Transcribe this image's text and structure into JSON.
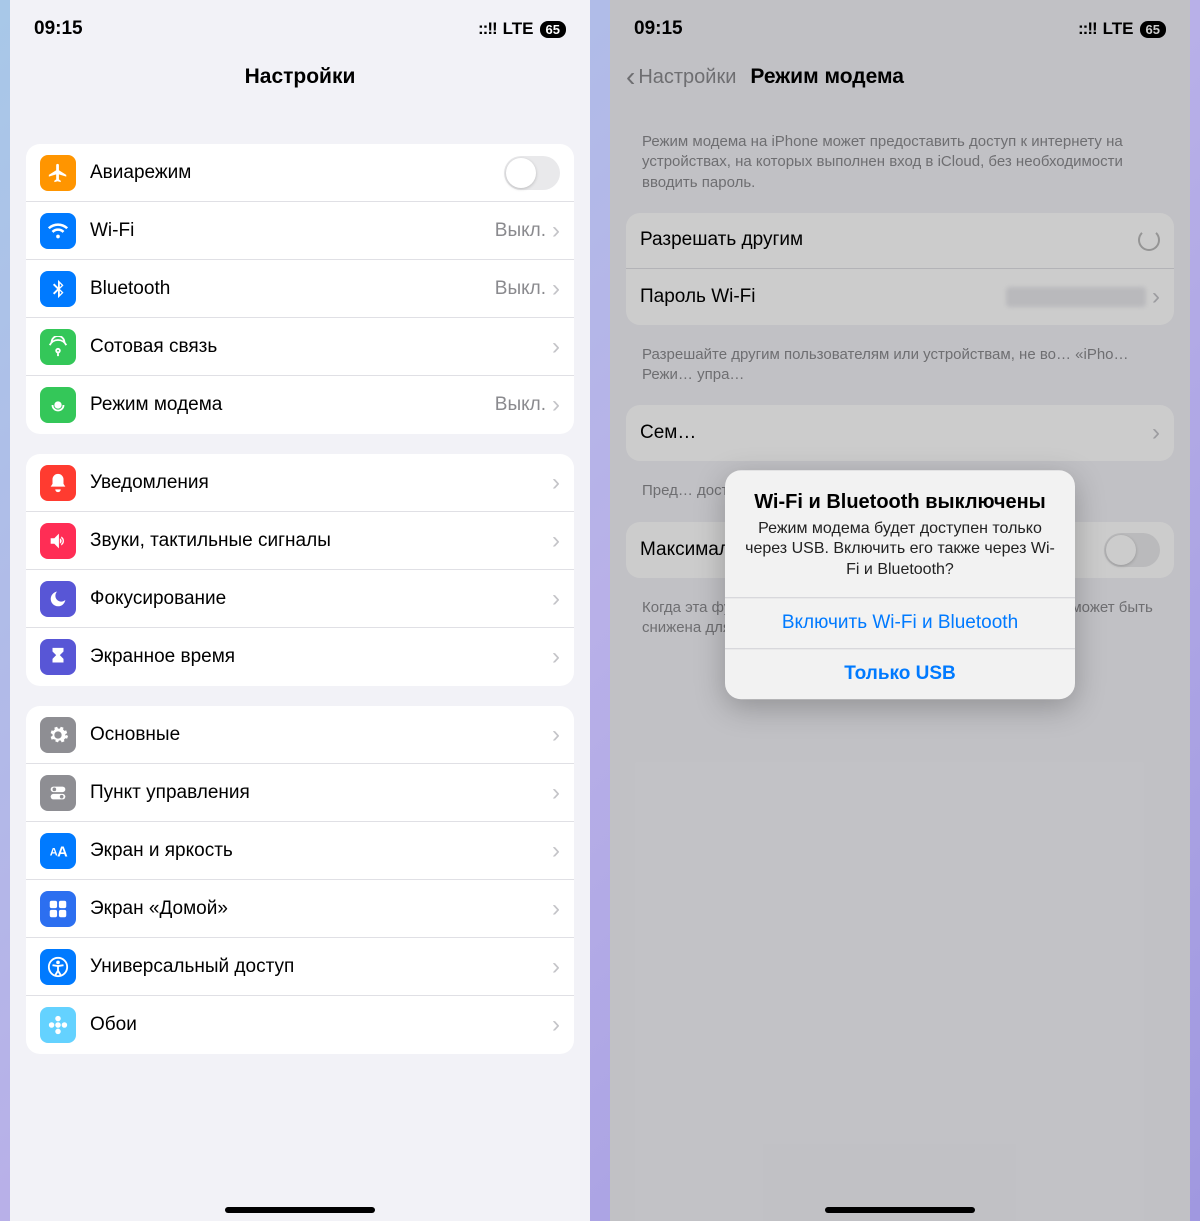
{
  "status": {
    "time": "09:15",
    "carrier": "LTE",
    "battery": "65"
  },
  "left": {
    "title": "Настройки",
    "groups": [
      {
        "rows": [
          {
            "icon": "airplane",
            "bg": "bg-orange",
            "label": "Авиарежим",
            "type": "toggle"
          },
          {
            "icon": "wifi",
            "bg": "bg-blue",
            "label": "Wi-Fi",
            "value": "Выкл.",
            "type": "link"
          },
          {
            "icon": "bluetooth",
            "bg": "bg-blue",
            "label": "Bluetooth",
            "value": "Выкл.",
            "type": "link"
          },
          {
            "icon": "cellular",
            "bg": "bg-green",
            "label": "Сотовая связь",
            "type": "link"
          },
          {
            "icon": "hotspot",
            "bg": "bg-green",
            "label": "Режим модема",
            "value": "Выкл.",
            "type": "link"
          }
        ]
      },
      {
        "rows": [
          {
            "icon": "bell",
            "bg": "bg-red",
            "label": "Уведомления",
            "type": "link"
          },
          {
            "icon": "speaker",
            "bg": "bg-pink",
            "label": "Звуки, тактильные сигналы",
            "type": "link"
          },
          {
            "icon": "moon",
            "bg": "bg-indigo",
            "label": "Фокусирование",
            "type": "link"
          },
          {
            "icon": "hourglass",
            "bg": "bg-indigo",
            "label": "Экранное время",
            "type": "link"
          }
        ]
      },
      {
        "rows": [
          {
            "icon": "gear",
            "bg": "bg-gray",
            "label": "Основные",
            "type": "link"
          },
          {
            "icon": "switches",
            "bg": "bg-grayd",
            "label": "Пункт управления",
            "type": "link"
          },
          {
            "icon": "aa",
            "bg": "bg-bluea",
            "label": "Экран и яркость",
            "type": "link"
          },
          {
            "icon": "grid",
            "bg": "bg-bluec",
            "label": "Экран «Домой»",
            "type": "link"
          },
          {
            "icon": "accessibility",
            "bg": "bg-blue",
            "label": "Универсальный доступ",
            "type": "link"
          },
          {
            "icon": "flower",
            "bg": "bg-teal",
            "label": "Обои",
            "type": "link"
          }
        ]
      }
    ]
  },
  "right": {
    "back": "Настройки",
    "title": "Режим модема",
    "note1": "Режим модема на iPhone может предоставить доступ к интернету на устройствах, на которых выполнен вход в iCloud, без необходимости вводить пароль.",
    "rows1": [
      {
        "label": "Разрешать другим",
        "type": "spinner"
      },
      {
        "label": "Пароль Wi-Fi",
        "type": "blurval"
      }
    ],
    "note2": "Разрешайте другим пользователям или устройствам, не во… «iPho… Режи… упра…",
    "rows2": [
      {
        "label": "Сем…",
        "type": "link"
      }
    ],
    "note3": "Пред… дост…",
    "rows3": [
      {
        "label": "Максимальная совместимость",
        "type": "toggle"
      }
    ],
    "note4": "Когда эта функция включена, скорость интернет-соединения может быть снижена для устройств, подключенных к точке доступа.",
    "alert": {
      "title": "Wi-Fi и Bluetooth выключены",
      "message": "Режим модема будет доступен только через USB. Включить его также через Wi-Fi и Bluetooth?",
      "button1": "Включить Wi-Fi и Bluetooth",
      "button2": "Только USB"
    }
  }
}
